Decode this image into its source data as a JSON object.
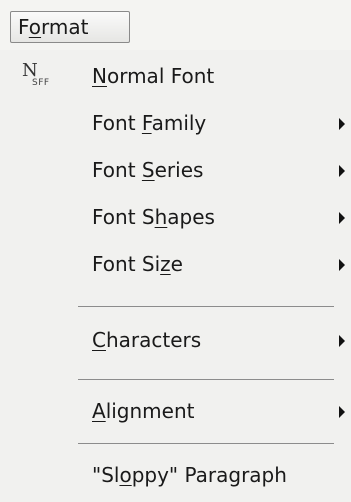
{
  "menubar": {
    "format": {
      "pre": "F",
      "mn": "o",
      "post": "rmat"
    }
  },
  "menu": {
    "normal_font": {
      "icon_big": "N",
      "icon_small": "SFF",
      "pre": "",
      "mn": "N",
      "post": "ormal Font"
    },
    "font_family": {
      "pre": "Font ",
      "mn": "F",
      "post": "amily"
    },
    "font_series": {
      "pre": "Font ",
      "mn": "S",
      "post": "eries"
    },
    "font_shapes": {
      "pre": "Font S",
      "mn": "h",
      "post": "apes"
    },
    "font_size": {
      "pre": "Font Si",
      "mn": "z",
      "post": "e"
    },
    "characters": {
      "pre": "",
      "mn": "C",
      "post": "haracters"
    },
    "alignment": {
      "pre": "",
      "mn": "A",
      "post": "lignment"
    },
    "sloppy": {
      "pre": "\"Sl",
      "mn": "o",
      "post": "ppy\" Paragraph"
    }
  }
}
